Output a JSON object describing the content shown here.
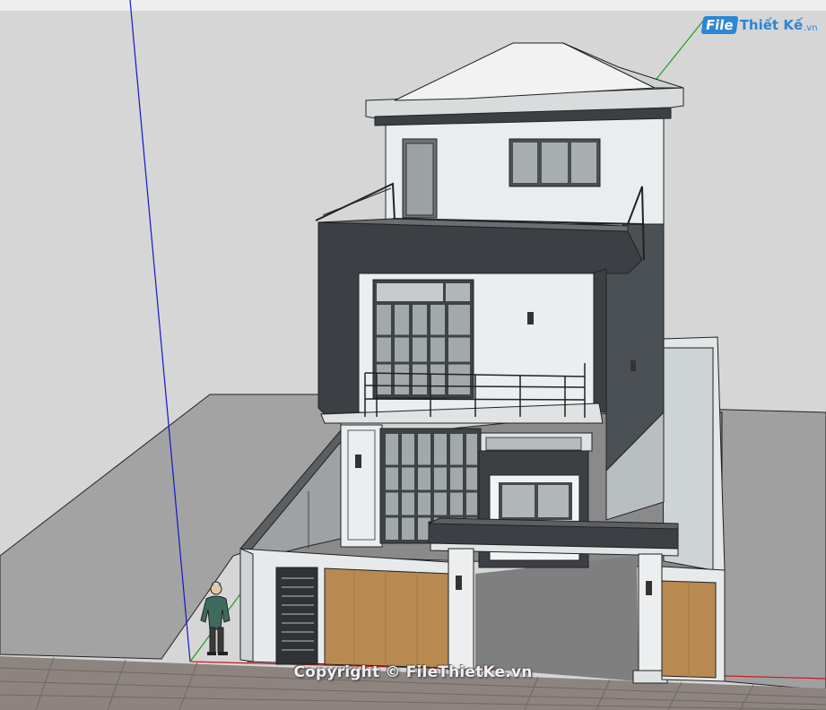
{
  "watermark": {
    "brand_prefix": "File",
    "brand_name": "Thiết Kế",
    "brand_tld": ".vn",
    "copyright": "Copyright © FileThietKe.vn"
  },
  "scene": {
    "axis_blue": "#1515c8",
    "axis_green": "#1a9e1a",
    "axis_red": "#c81818",
    "sky_color": "#d6d6d6",
    "ground_color": "#9e9e9e",
    "dark_trim": "#3c4044",
    "wall_color": "#e8ecee",
    "wood_color": "#b88a52"
  }
}
